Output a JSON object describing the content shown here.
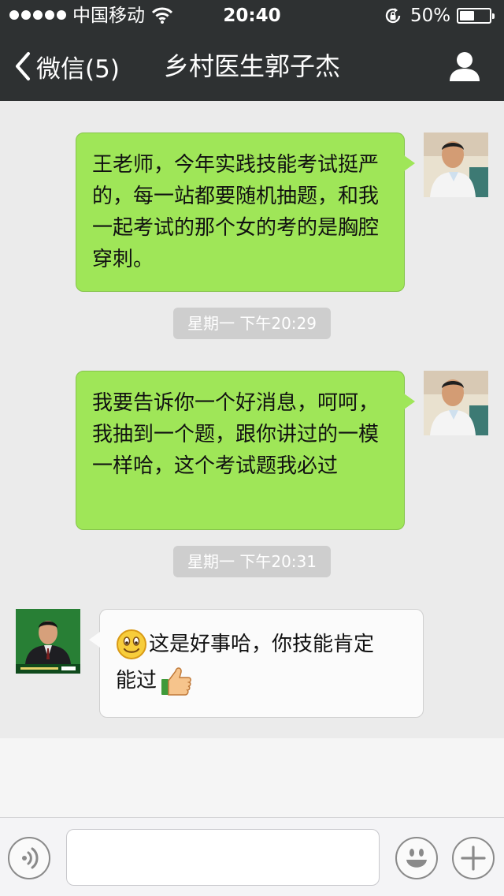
{
  "status_bar": {
    "carrier": "中国移动",
    "time": "20:40",
    "battery_text": "50%",
    "battery_level": 0.5
  },
  "nav": {
    "back_label": "微信(5)",
    "title": "乡村医生郭子杰"
  },
  "messages": [
    {
      "type": "sent",
      "text": "王老师，今年实践技能考试挺严的，每一站都要随机抽题，和我一起考试的那个女的考的是胸腔穿刺。"
    },
    {
      "type": "timestamp",
      "text": "星期一 下午20:29"
    },
    {
      "type": "sent",
      "text": "我要告诉你一个好消息，呵呵，我抽到一个题，跟你讲过的一模一样哈，这个考试题我必过"
    },
    {
      "type": "timestamp",
      "text": "星期一 下午20:31"
    },
    {
      "type": "received",
      "text_line1": "这是好事哈，你技能肯定",
      "text_line2": "能过"
    }
  ],
  "colors": {
    "header_bg": "#2e3132",
    "sent_bubble": "#9fe658",
    "received_bubble": "#fbfbfb",
    "timestamp_bg": "#cecece",
    "chat_bg": "#ebebeb"
  },
  "icons": [
    "signal-dots-icon",
    "wifi-icon",
    "rotation-lock-icon",
    "battery-icon",
    "back-chevron-icon",
    "profile-icon",
    "voice-icon",
    "emoji-icon",
    "plus-icon",
    "smile-emoji",
    "thumbs-up-emoji"
  ]
}
